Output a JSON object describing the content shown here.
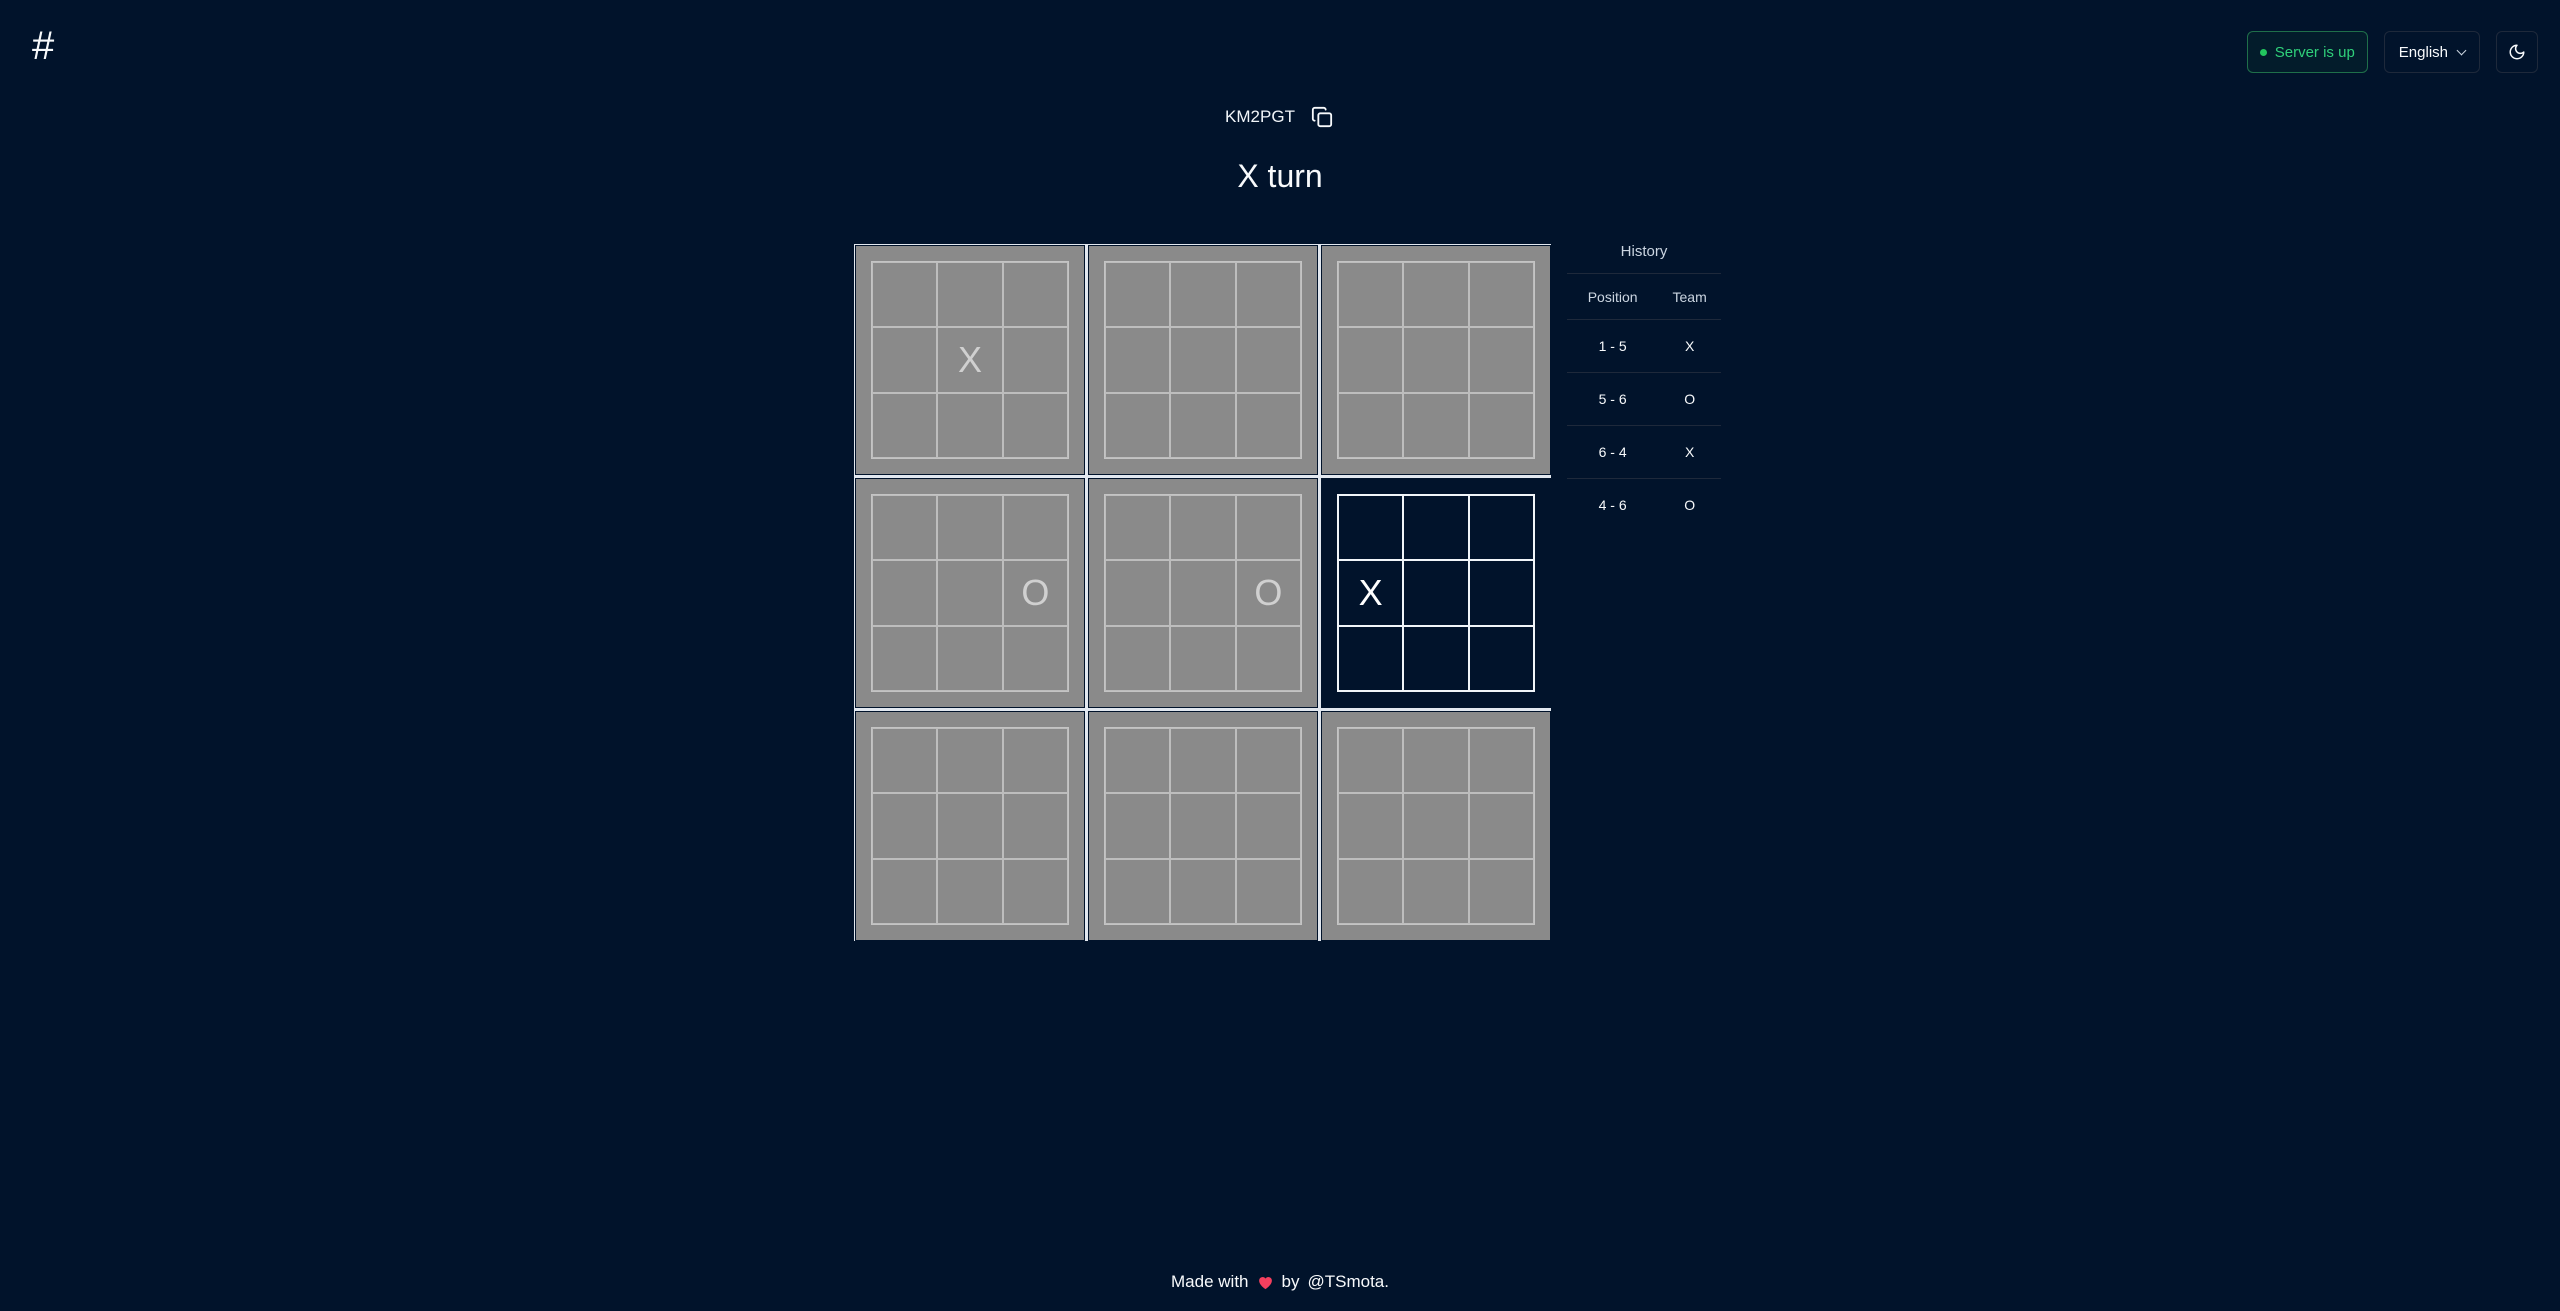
{
  "header": {
    "logo": "#",
    "server_status": "Server is up",
    "language": "English",
    "theme_icon": "moon-icon"
  },
  "room": {
    "code": "KM2PGT",
    "copy_icon": "copy-icon"
  },
  "turn_text": "X turn",
  "board": {
    "active_board": 6,
    "cells": [
      [
        "",
        "",
        "",
        "",
        "X",
        "",
        "",
        "",
        ""
      ],
      [
        "",
        "",
        "",
        "",
        "",
        "",
        "",
        "",
        ""
      ],
      [
        "",
        "",
        "",
        "",
        "",
        "",
        "",
        "",
        ""
      ],
      [
        "",
        "",
        "",
        "",
        "",
        "O",
        "",
        "",
        ""
      ],
      [
        "",
        "",
        "",
        "",
        "",
        "O",
        "",
        "",
        ""
      ],
      [
        "",
        "",
        "",
        "X",
        "",
        "",
        "",
        "",
        ""
      ],
      [
        "",
        "",
        "",
        "",
        "",
        "",
        "",
        "",
        ""
      ],
      [
        "",
        "",
        "",
        "",
        "",
        "",
        "",
        "",
        ""
      ],
      [
        "",
        "",
        "",
        "",
        "",
        "",
        "",
        "",
        ""
      ]
    ]
  },
  "history": {
    "caption": "History",
    "columns": [
      "Position",
      "Team"
    ],
    "rows": [
      {
        "position": "1 - 5",
        "team": "X"
      },
      {
        "position": "5 - 6",
        "team": "O"
      },
      {
        "position": "6 - 4",
        "team": "X"
      },
      {
        "position": "4 - 6",
        "team": "O"
      }
    ]
  },
  "footer": {
    "made_with": "Made with",
    "heart_icon": "heart-icon",
    "by": "by",
    "author": "@TSmota."
  },
  "colors": {
    "background": "#01132b",
    "server_ok": "#2fd07a",
    "disabled_board": "#8a8a8a",
    "heart": "#f43f5e"
  }
}
